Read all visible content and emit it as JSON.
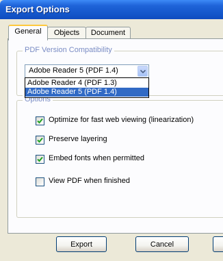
{
  "window": {
    "title": "Export Options"
  },
  "tabs": [
    {
      "label": "General",
      "active": true
    },
    {
      "label": "Objects",
      "active": false
    },
    {
      "label": "Document",
      "active": false
    }
  ],
  "pdf_version": {
    "group_label": "PDF Version Compatibility",
    "selected": "Adobe Reader 5 (PDF 1.4)",
    "options": [
      "Adobe Reader 4 (PDF 1.3)",
      "Adobe Reader 5 (PDF 1.4)"
    ],
    "highlighted_option": "Adobe Reader 5 (PDF 1.4)"
  },
  "options": {
    "group_label": "Options",
    "checkboxes": [
      {
        "label": "Optimize for fast web viewing (linearization)",
        "checked": true
      },
      {
        "label": "Preserve layering",
        "checked": true
      },
      {
        "label": "Embed fonts when permitted",
        "checked": true
      },
      {
        "label": "View PDF when finished",
        "checked": false
      }
    ]
  },
  "buttons": {
    "export": "Export",
    "cancel": "Cancel"
  },
  "colors": {
    "title_bar": "#1457cb",
    "selection": "#316ac5",
    "group_label": "#7a8cc4",
    "check_mark": "#21a121"
  }
}
